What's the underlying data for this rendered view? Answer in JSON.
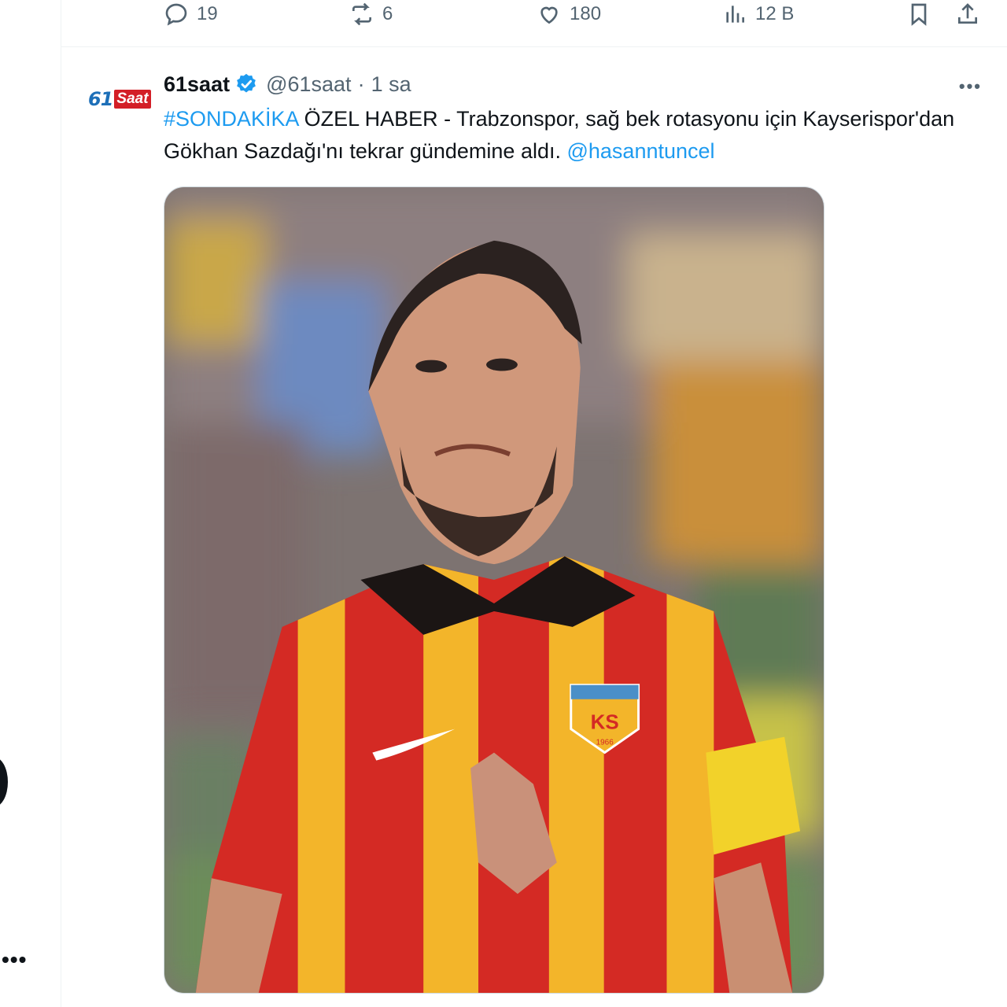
{
  "actions": {
    "replies": "19",
    "reposts": "6",
    "likes": "180",
    "views": "12 B"
  },
  "tweet": {
    "author_name": "61saat",
    "handle": "@61saat",
    "separator": "·",
    "time": "1 sa",
    "logo_number": "61",
    "logo_word": "Saat",
    "hashtag": "#SONDAKİKA",
    "text_main": " ÖZEL HABER - Trabzonspor, sağ bek rotasyonu için Kayserispor'dan Gökhan Sazdağı'nı tekrar gündemine aldı. ",
    "mention": "@hasanntuncel",
    "more_label": "•••",
    "badge_initials": "KS",
    "badge_year": "1966"
  },
  "rail": {
    "more_label": "•••"
  },
  "colors": {
    "accent": "#1d9bf0",
    "muted": "#536471",
    "jersey_red": "#d42a24",
    "jersey_yellow": "#f3b52a",
    "logo_red": "#d31f27"
  },
  "icons": [
    "reply-icon",
    "repost-icon",
    "like-icon",
    "views-icon",
    "bookmark-icon",
    "share-icon",
    "verified-icon",
    "more-icon"
  ]
}
